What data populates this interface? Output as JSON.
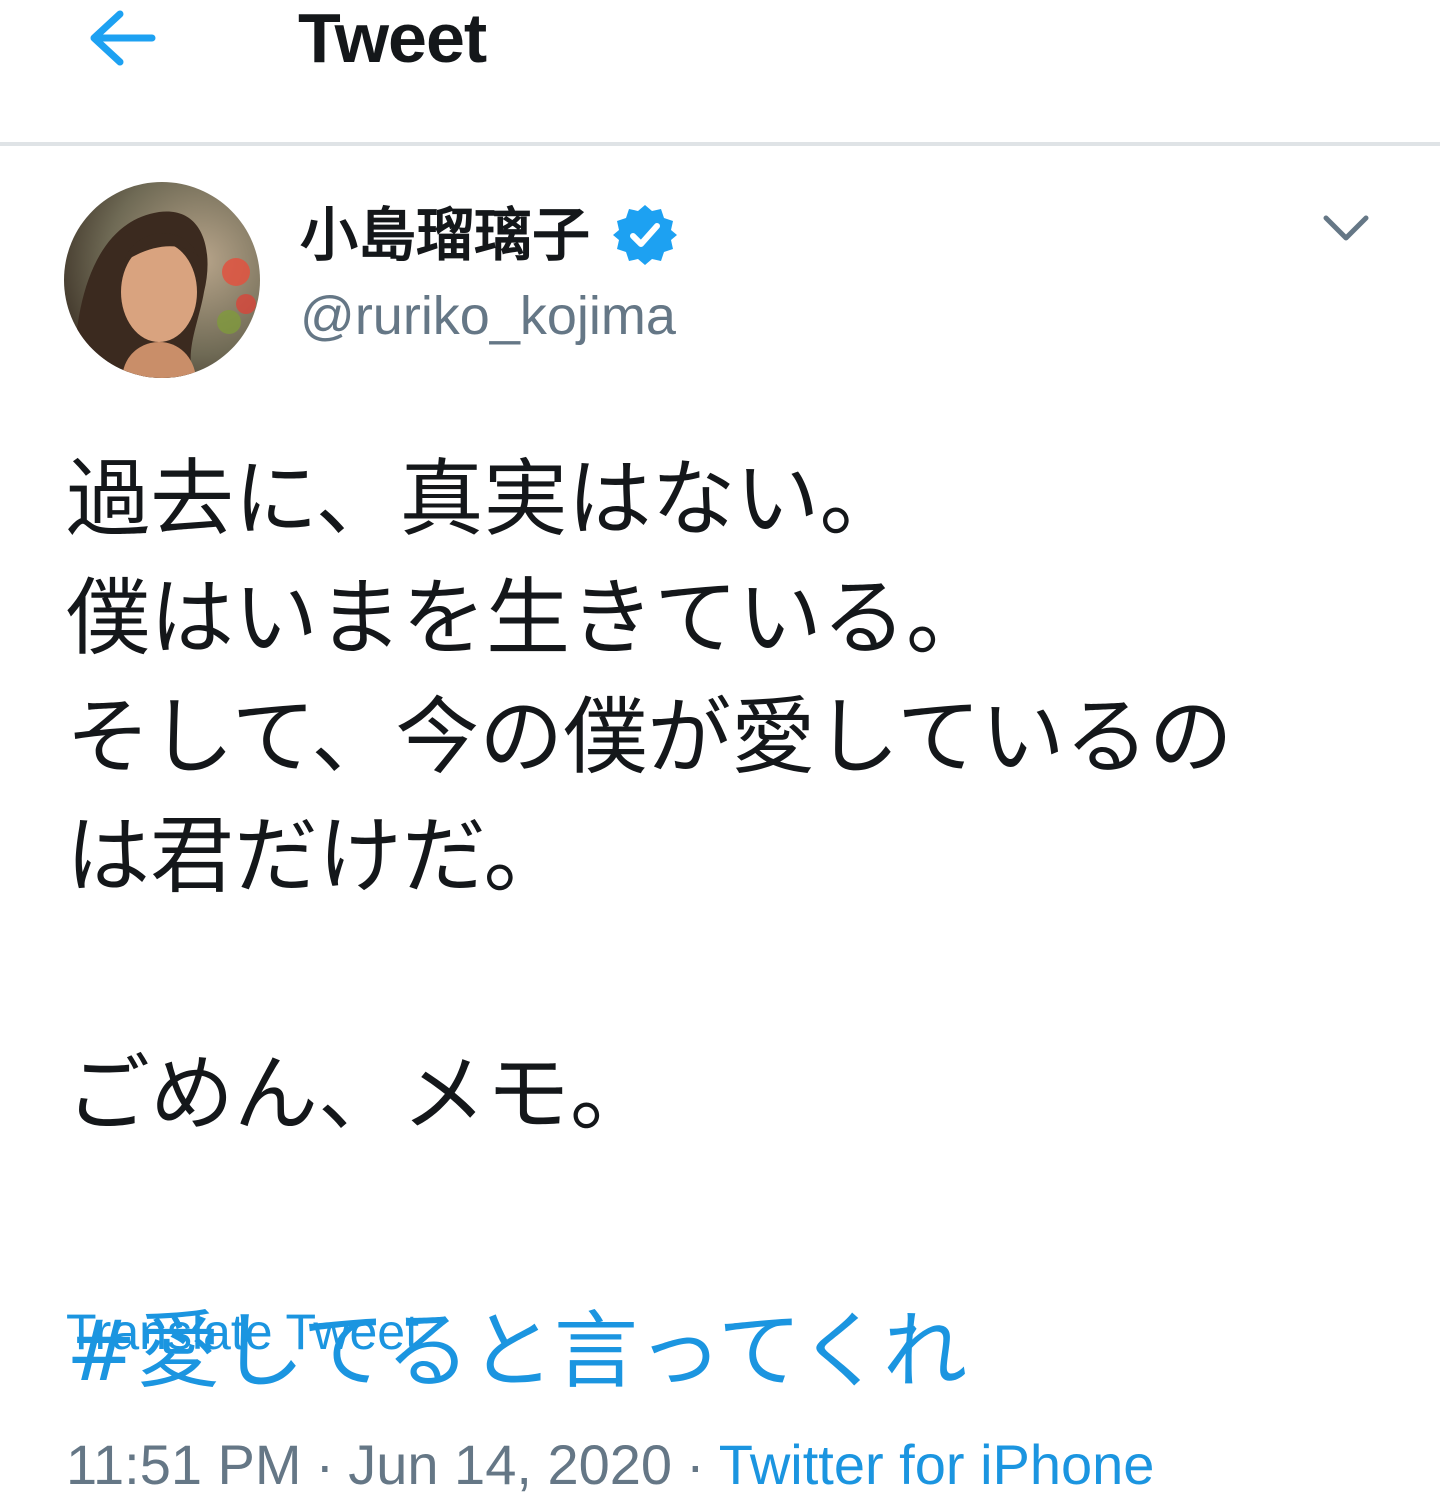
{
  "header": {
    "title": "Tweet",
    "back_icon": "arrow-left-icon"
  },
  "tweet": {
    "author": {
      "display_name": "小島瑠璃子",
      "handle": "@ruriko_kojima",
      "verified_icon": "verified-badge-icon"
    },
    "menu_icon": "chevron-down-icon",
    "text_lines": [
      "過去に、真実はない。",
      "僕はいまを生きている。",
      "そして、今の僕が愛しているの",
      "は君だけだ。",
      "",
      "ごめん、メモ。"
    ],
    "hashtag": "#愛してると言ってくれ",
    "translate_label": "Translate Tweet",
    "time": "11:51 PM",
    "date": "Jun 14, 2020",
    "separator": "·",
    "source": "Twitter for iPhone"
  },
  "colors": {
    "link": "#1b95e0",
    "text": "#14171a",
    "secondary": "#657786",
    "divider": "#dfe3e6",
    "verified": "#1da1f2"
  }
}
